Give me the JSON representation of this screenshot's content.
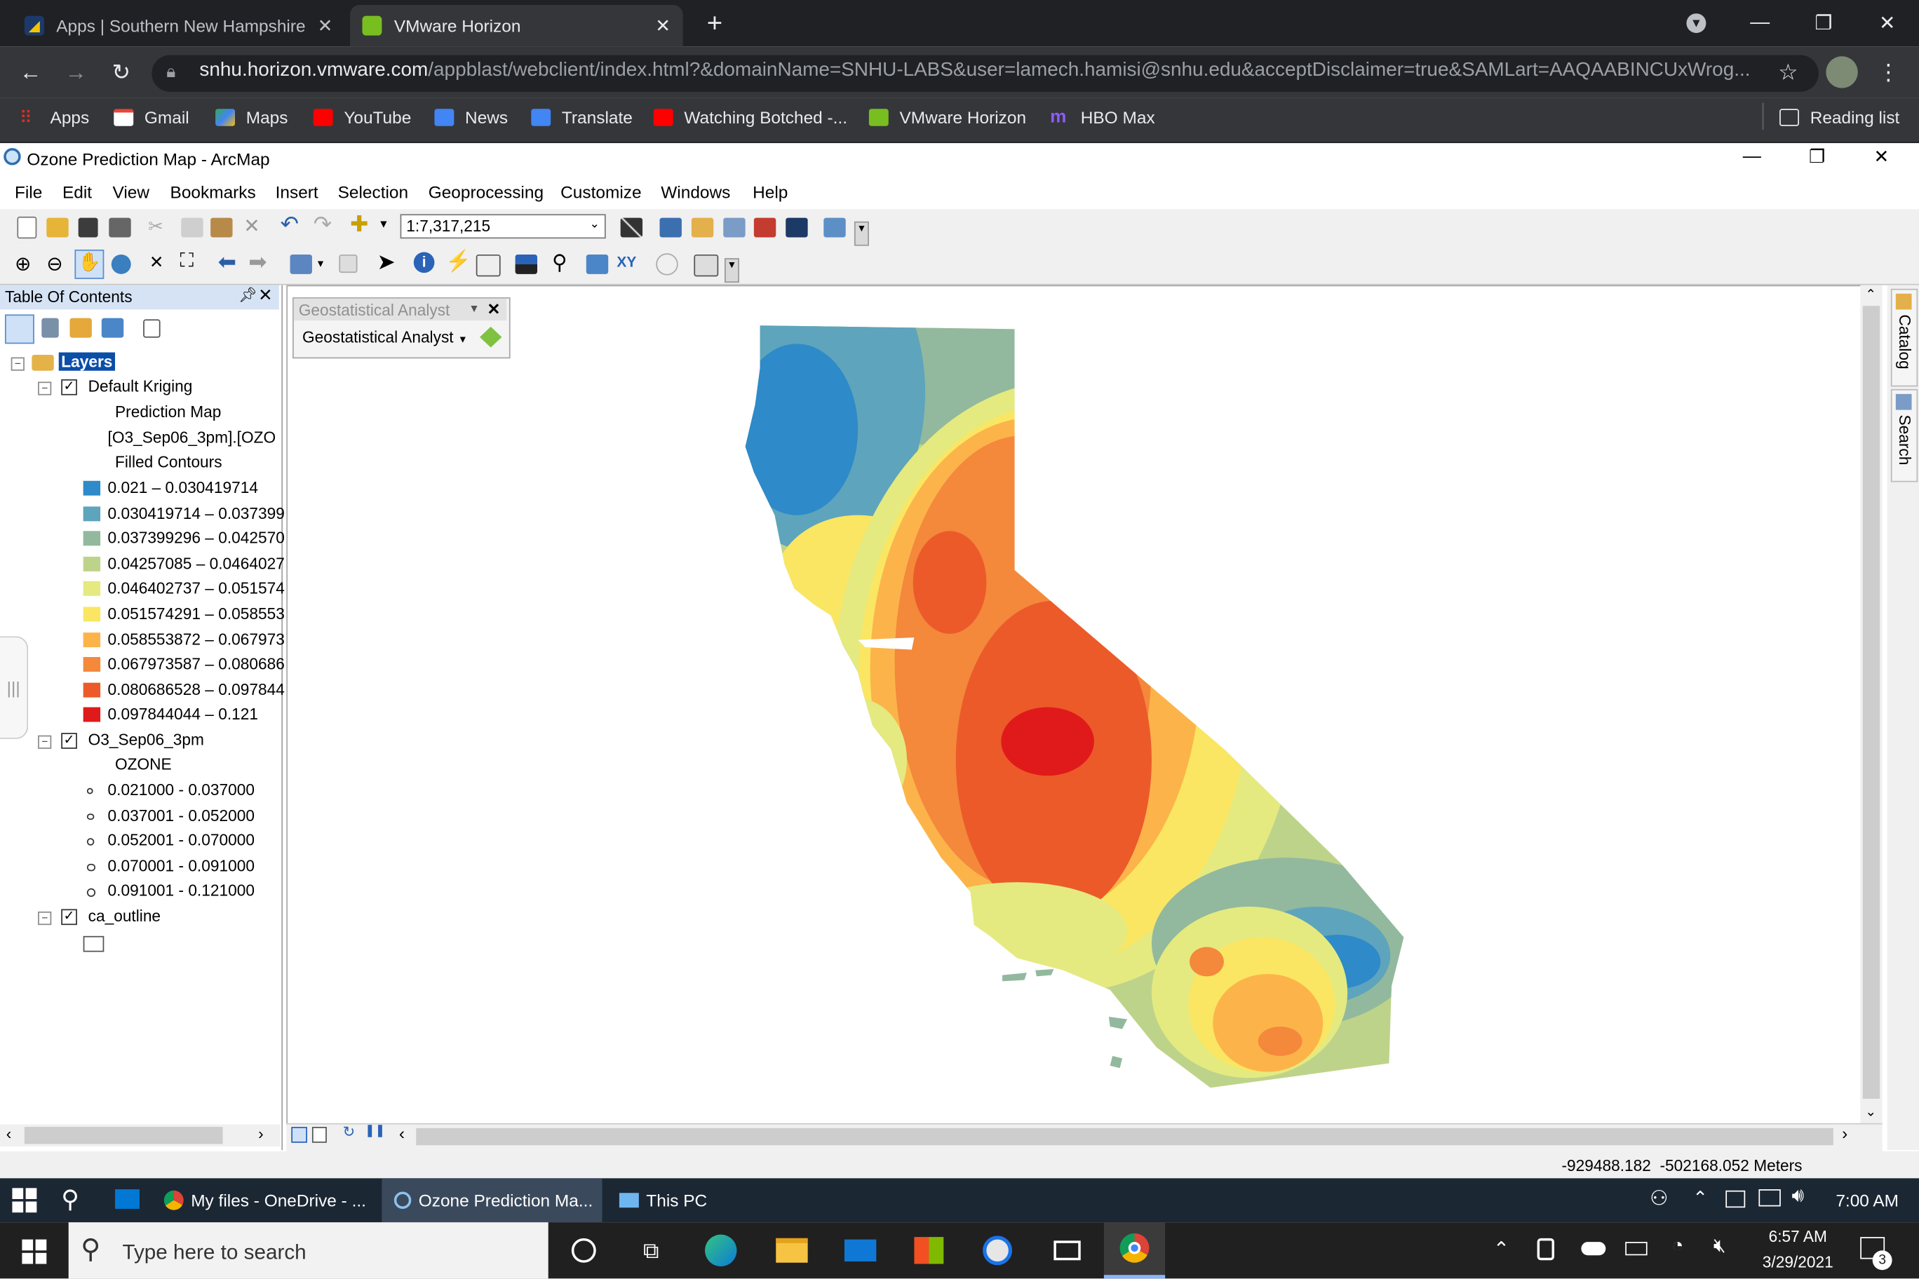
{
  "browser": {
    "tabs": [
      {
        "label": "Apps | Southern New Hampshire"
      },
      {
        "label": "VMware Horizon"
      }
    ],
    "url_host": "snhu.horizon.vmware.com",
    "url_rest": "/appblast/webclient/index.html?&domainName=SNHU-LABS&user=lamech.hamisi@snhu.edu&acceptDisclaimer=true&SAMLart=AAQAABINCUxWrog...",
    "bookmarks": [
      "Apps",
      "Gmail",
      "Maps",
      "YouTube",
      "News",
      "Translate",
      "Watching Botched -...",
      "VMware Horizon",
      "HBO Max"
    ],
    "reading_list": "Reading list"
  },
  "arcmap": {
    "title": "Ozone Prediction Map - ArcMap",
    "menus": [
      "File",
      "Edit",
      "View",
      "Bookmarks",
      "Insert",
      "Selection",
      "Geoprocessing",
      "Customize",
      "Windows",
      "Help"
    ],
    "scale": "1:7,317,215",
    "toc": {
      "title": "Table Of Contents",
      "layers_root": "Layers",
      "kriging_name": "Default Kriging",
      "kriging_sub1": "Prediction Map",
      "kriging_sub2": "[O3_Sep06_3pm].[OZO",
      "kriging_sub3": "Filled Contours",
      "classes": [
        {
          "label": "0.021 – 0.030419714",
          "color": "#2e8ac8"
        },
        {
          "label": "0.030419714 – 0.037399",
          "color": "#5ea4bc"
        },
        {
          "label": "0.037399296 – 0.042570",
          "color": "#92b99e"
        },
        {
          "label": "0.04257085 – 0.0464027",
          "color": "#bed38a"
        },
        {
          "label": "0.046402737 – 0.051574",
          "color": "#e4ea80"
        },
        {
          "label": "0.051574291 – 0.058553",
          "color": "#fae663"
        },
        {
          "label": "0.058553872 – 0.067973",
          "color": "#fcb44a"
        },
        {
          "label": "0.067973587 – 0.080686",
          "color": "#f4883b"
        },
        {
          "label": "0.080686528 – 0.097844",
          "color": "#ec5a2a"
        },
        {
          "label": "0.097844044 – 0.121",
          "color": "#e01a1a"
        }
      ],
      "points_layer": "O3_Sep06_3pm",
      "points_field": "OZONE",
      "point_classes": [
        "0.021000 - 0.037000",
        "0.037001 - 0.052000",
        "0.052001 - 0.070000",
        "0.070001 - 0.091000",
        "0.091001 - 0.121000"
      ],
      "outline_layer": "ca_outline"
    },
    "ga_toolbar_title": "Geostatistical Analyst",
    "ga_toolbar_menu": "Geostatistical Analyst",
    "side_tabs": [
      "Catalog",
      "Search"
    ],
    "status_coords": "-929488.182  -502168.052 Meters"
  },
  "remote_taskbar": {
    "items": [
      "My files - OneDrive - ...",
      "Ozone Prediction Ma...",
      "This PC"
    ],
    "time": "7:00 AM"
  },
  "windows_taskbar": {
    "search_placeholder": "Type here to search",
    "time": "6:57 AM",
    "date": "3/29/2021",
    "notifications": "3"
  }
}
